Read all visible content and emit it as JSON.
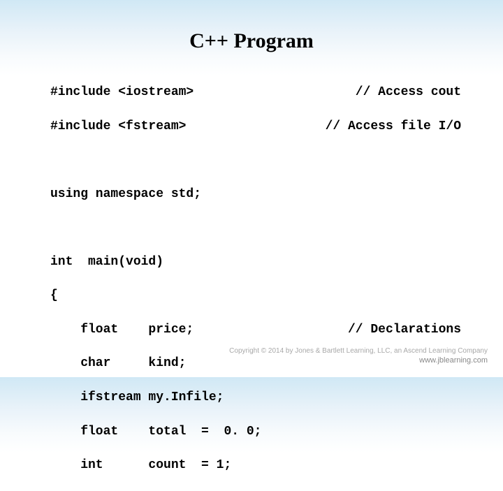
{
  "title": "C++ Program",
  "code": {
    "line1_left": "#include <iostream>",
    "line1_right": "// Access cout",
    "line2_left": "#include <fstream>",
    "line2_right": "// Access file I/O",
    "line3": "using namespace std;",
    "line4": "int  main(void)",
    "line5": "{",
    "line6_left": "    float    price;",
    "line6_right": "// Declarations",
    "line7": "    char     kind;",
    "line8": "    ifstream my.Infile;",
    "line9": "    float    total  =  0. 0;",
    "line10": "    int      count  = 1;"
  },
  "footer": {
    "copyright": "Copyright © 2014 by Jones & Bartlett Learning, LLC, an Ascend Learning Company",
    "url": "www.jblearning.com"
  }
}
